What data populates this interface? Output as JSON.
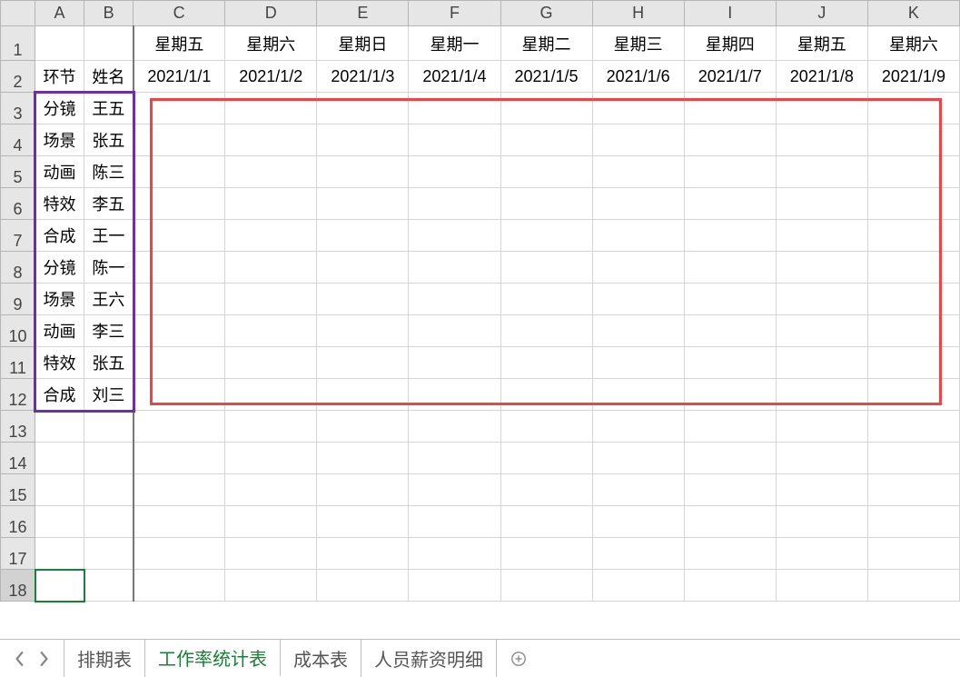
{
  "columns": [
    "A",
    "B",
    "C",
    "D",
    "E",
    "F",
    "G",
    "H",
    "I",
    "J",
    "K"
  ],
  "row_count": 18,
  "active_row": 18,
  "header_row1": {
    "A": "",
    "B": "",
    "C": "星期五",
    "D": "星期六",
    "E": "星期日",
    "F": "星期一",
    "G": "星期二",
    "H": "星期三",
    "I": "星期四",
    "J": "星期五",
    "K": "星期六"
  },
  "header_row2": {
    "A": "环节",
    "B": "姓名",
    "C": "2021/1/1",
    "D": "2021/1/2",
    "E": "2021/1/3",
    "F": "2021/1/4",
    "G": "2021/1/5",
    "H": "2021/1/6",
    "I": "2021/1/7",
    "J": "2021/1/8",
    "K": "2021/1/9"
  },
  "data_rows": [
    {
      "A": "分镜",
      "B": "王五"
    },
    {
      "A": "场景",
      "B": "张五"
    },
    {
      "A": "动画",
      "B": "陈三"
    },
    {
      "A": "特效",
      "B": "李五"
    },
    {
      "A": "合成",
      "B": "王一"
    },
    {
      "A": "分镜",
      "B": "陈一"
    },
    {
      "A": "场景",
      "B": "王六"
    },
    {
      "A": "动画",
      "B": "李三"
    },
    {
      "A": "特效",
      "B": "张五"
    },
    {
      "A": "合成",
      "B": "刘三"
    }
  ],
  "tabs": [
    {
      "label": "排期表",
      "active": false
    },
    {
      "label": "工作率统计表",
      "active": true
    },
    {
      "label": "成本表",
      "active": false
    },
    {
      "label": "人员薪资明细",
      "active": false
    }
  ],
  "boxes": {
    "purple": {
      "from": "A3",
      "to": "B12"
    },
    "red": {
      "from": "C3",
      "to": "K12"
    }
  }
}
